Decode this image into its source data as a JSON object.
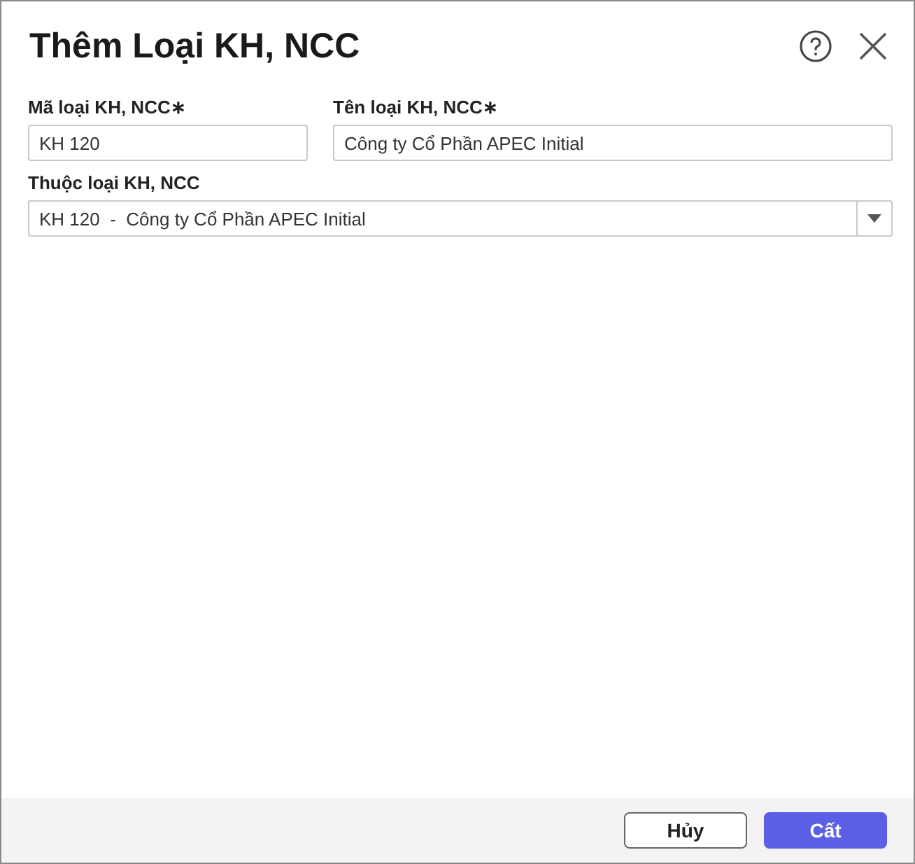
{
  "window": {
    "title": "Thêm Loại KH, NCC"
  },
  "fields": [
    {
      "label": "Mã loại KH, NCC∗",
      "value": "KH 120"
    },
    {
      "label": "Tên loại KH, NCC∗",
      "value": "Công ty Cổ Phần APEC Initial"
    }
  ],
  "parent": {
    "label": "Thuộc loại KH, NCC",
    "value": "KH 120  -  Công ty Cổ Phần APEC Initial"
  },
  "buttons": [
    {
      "label": "Hủy",
      "kind": "secondary"
    },
    {
      "label": "Cất",
      "kind": "primary"
    }
  ]
}
